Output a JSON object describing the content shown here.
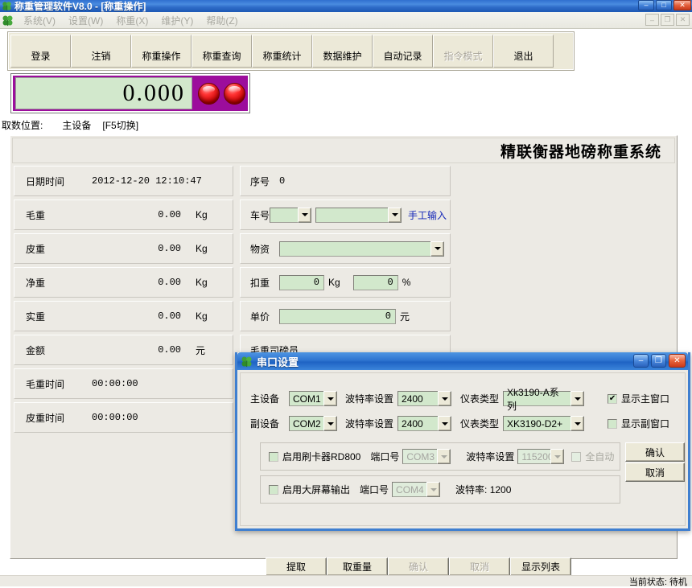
{
  "app": {
    "title": "称重管理软件V8.0  -  [称重操作]",
    "window_buttons": {
      "minimize": "–",
      "maximize": "□",
      "close": "✕"
    },
    "mdi_buttons": {
      "minimize": "–",
      "restore": "❐",
      "close": "✕"
    }
  },
  "menu": {
    "items": [
      {
        "label": "系统(V)"
      },
      {
        "label": "设置(W)"
      },
      {
        "label": "称重(X)"
      },
      {
        "label": "维护(Y)"
      },
      {
        "label": "帮助(Z)"
      }
    ]
  },
  "toolbar": {
    "buttons": [
      {
        "label": "登录",
        "disabled": false
      },
      {
        "label": "注销",
        "disabled": false
      },
      {
        "label": "称重操作",
        "disabled": false
      },
      {
        "label": "称重查询",
        "disabled": false
      },
      {
        "label": "称重统计",
        "disabled": false
      },
      {
        "label": "数据维护",
        "disabled": false
      },
      {
        "label": "自动记录",
        "disabled": false
      },
      {
        "label": "指令模式",
        "disabled": true
      },
      {
        "label": "退出",
        "disabled": false
      }
    ]
  },
  "weight_display": {
    "value": "0.000",
    "lamp_color": "#d40000",
    "panel_color": "#9c0d9c",
    "screen_color": "#d2e8cc"
  },
  "source_position": {
    "label": "取数位置:",
    "value": "主设备",
    "hotkey": "[F5切换]"
  },
  "form": {
    "header_title": "精联衡器地磅称重系统",
    "left_rows": [
      {
        "label": "日期时间",
        "value": "2012-12-20 12:10:47",
        "unit": ""
      },
      {
        "label": "毛重",
        "value": "0.00",
        "unit": "Kg"
      },
      {
        "label": "皮重",
        "value": "0.00",
        "unit": "Kg"
      },
      {
        "label": "净重",
        "value": "0.00",
        "unit": "Kg"
      },
      {
        "label": "实重",
        "value": "0.00",
        "unit": "Kg"
      },
      {
        "label": "金额",
        "value": "0.00",
        "unit": "元"
      },
      {
        "label": "毛重时间",
        "value": "00:00:00",
        "unit": ""
      },
      {
        "label": "皮重时间",
        "value": "00:00:00",
        "unit": ""
      }
    ],
    "right": {
      "serial_label": "序号",
      "serial_value": "0",
      "vehicle_label": "车号",
      "vehicle_combo1": "",
      "vehicle_combo2": "",
      "manual_input_link": "手工输入",
      "goods_label": "物资",
      "goods_value": "",
      "deduct_label": "扣重",
      "deduct_kg": "0",
      "deduct_kg_unit": "Kg",
      "deduct_pct": "0",
      "deduct_pct_unit": "%",
      "price_label": "单价",
      "price_value": "0",
      "price_unit": "元",
      "gross_operator_label": "毛重司磅员"
    }
  },
  "bottom_buttons": [
    {
      "label": "提取",
      "disabled": false
    },
    {
      "label": "取重量",
      "disabled": false
    },
    {
      "label": "确认",
      "disabled": true
    },
    {
      "label": "取消",
      "disabled": true
    },
    {
      "label": "显示列表",
      "disabled": false
    }
  ],
  "statusbar": {
    "text": "当前状态: 待机"
  },
  "dialog": {
    "title": "串口设置",
    "buttons": {
      "minimize": "–",
      "maximize": "❐",
      "close": "✕"
    },
    "row_main": {
      "device_label": "主设备",
      "device_port": "COM1",
      "baud_label": "波特率设置",
      "baud_value": "2400",
      "meter_label": "仪表类型",
      "meter_value": "Xk3190-A系列",
      "show_checkbox_label": "显示主窗口",
      "show_checkbox_checked": true
    },
    "row_sub": {
      "device_label": "副设备",
      "device_port": "COM2",
      "baud_label": "波特率设置",
      "baud_value": "2400",
      "meter_label": "仪表类型",
      "meter_value": "XK3190-D2+",
      "show_checkbox_label": "显示副窗口",
      "show_checkbox_checked": false
    },
    "row_card": {
      "enable_label": "启用刷卡器RD800",
      "enable_checked": false,
      "port_label": "端口号",
      "port_value": "COM3",
      "baud_label": "波特率设置",
      "baud_value": "115200",
      "auto_label": "全自动",
      "auto_checked": false
    },
    "row_screen": {
      "enable_label": "启用大屏幕输出",
      "enable_checked": false,
      "port_label": "端口号",
      "port_value": "COM4",
      "baud_text": "波特率: 1200"
    },
    "ok_label": "确认",
    "cancel_label": "取消"
  }
}
